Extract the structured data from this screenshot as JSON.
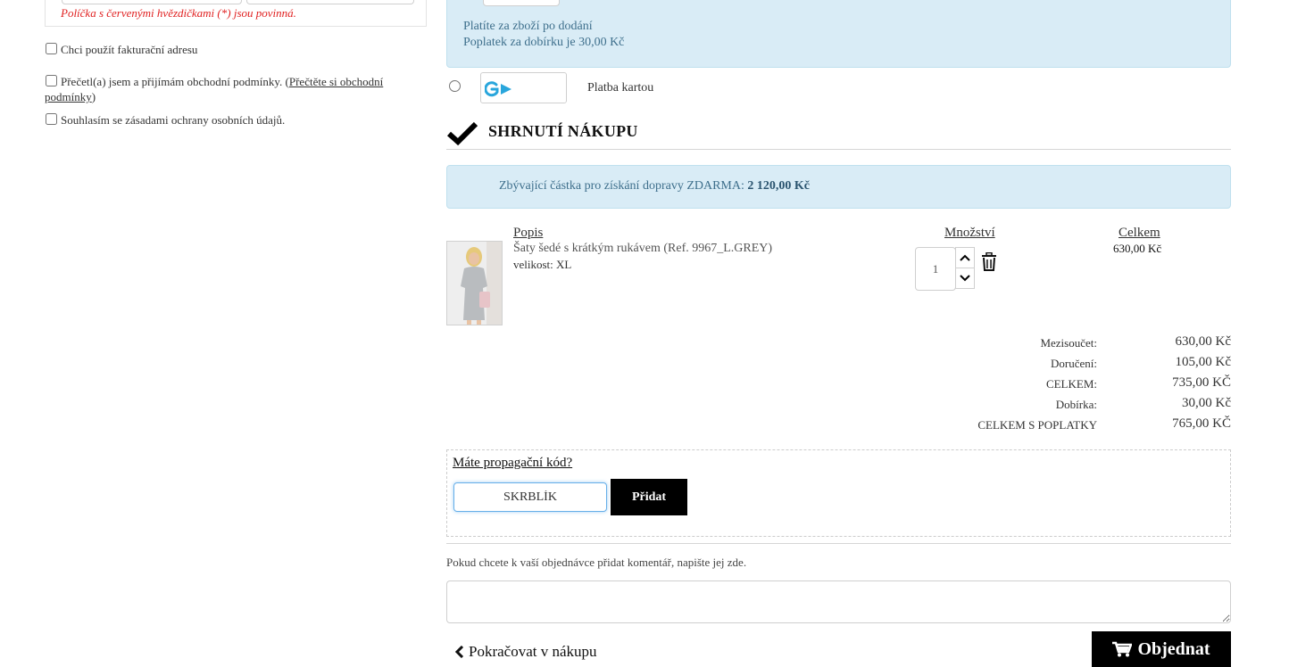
{
  "form": {
    "required_note": "Políčka s červenými hvězdičkami (*) jsou povinná.",
    "billing_checkbox": "Chci použít fakturační adresu",
    "terms_text": "Přečetl(a) jsem a přijímám obchodní podmínky.",
    "terms_link_open": "(",
    "terms_link": "Přečtěte si obchodní podmínky",
    "terms_link_close": ")",
    "privacy_checkbox": "Souhlasím se zásadami ochrany osobních údajů."
  },
  "payment": {
    "cod_line1": "Platíte za zboží po dodání",
    "cod_line2": "Poplatek za dobírku je 30,00 Kč",
    "card_label": "Platba kartou",
    "card_logo_icon": "gopay-logo",
    "card_logo_color": "#29a6dc"
  },
  "summary": {
    "title": "SHRNUTÍ NÁKUPU",
    "free_shipping_text": "Zbývající částka pro získání dopravy ZDARMA:",
    "free_shipping_amount": "2 120,00 Kč"
  },
  "cart": {
    "headers": {
      "description": "Popis",
      "quantity": "Množství",
      "total": "Celkem"
    },
    "item": {
      "name": "Šaty šedé s krátkým rukávem (Ref. 9967_L.GREY)",
      "size": "velikost: XL",
      "quantity": "1",
      "total": "630,00 Kč"
    }
  },
  "totals": [
    {
      "label": "Mezisoučet:",
      "value": "630,00 Kč"
    },
    {
      "label": "Doručení:",
      "value": "105,00 Kč"
    },
    {
      "label": "CELKEM:",
      "value": "735,00 KČ"
    },
    {
      "label": "Dobírka:",
      "value": "30,00 Kč"
    },
    {
      "label": "CELKEM S POPLATKY",
      "value": "765,00 KČ"
    }
  ],
  "promo": {
    "title": "Máte propagační kód?",
    "code_value": "SKRBLÍK",
    "add_button": "Přidat"
  },
  "comment": {
    "hint": "Pokud chcete k vaší objednávce přidat komentář, napište jej zde."
  },
  "actions": {
    "continue": "Pokračovat v nákupu",
    "order": "Objednat"
  }
}
